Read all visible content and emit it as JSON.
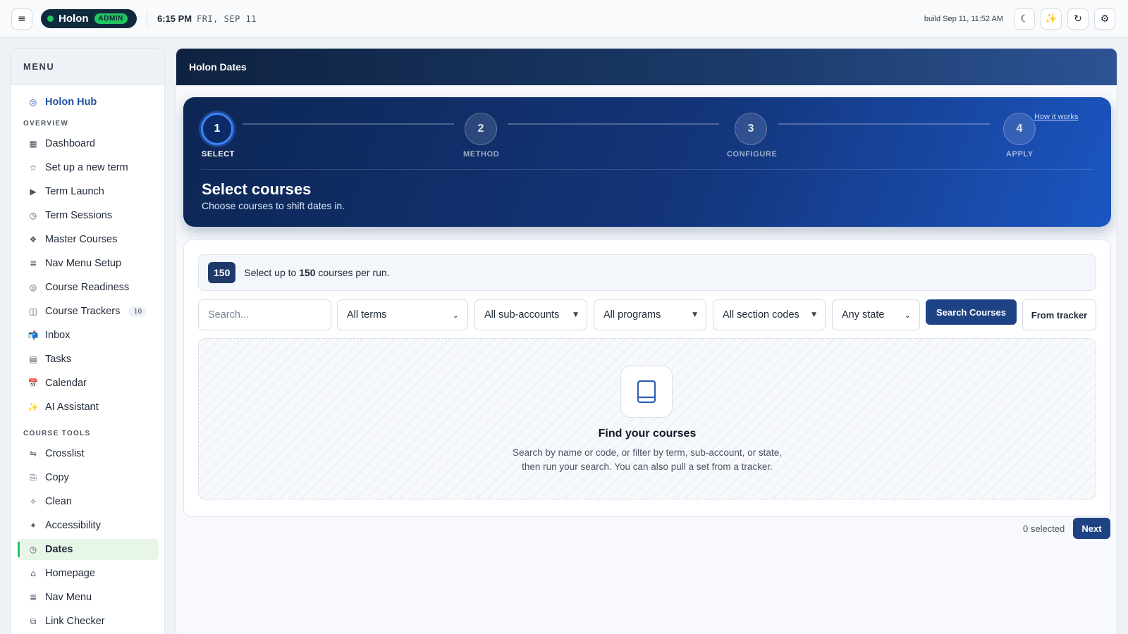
{
  "topbar": {
    "menu_icon": "hamburger-icon",
    "brand_name": "Holon",
    "brand_badge": "ADMIN",
    "time": "6:15 PM",
    "date": "FRI, SEP 11",
    "build": "build Sep 11, 11:52 AM",
    "actions": [
      {
        "icon": "moon-icon",
        "glyph": "☾"
      },
      {
        "icon": "sparkles-icon",
        "glyph": "✨"
      },
      {
        "icon": "refresh-icon",
        "glyph": "↻"
      },
      {
        "icon": "gear-icon",
        "glyph": "⚙"
      }
    ]
  },
  "sidebar": {
    "heading": "MENU",
    "hub": {
      "label": "Holon Hub",
      "glyph": "◎"
    },
    "sections": [
      {
        "title": "OVERVIEW",
        "items": [
          {
            "label": "Dashboard",
            "glyph": "▦"
          },
          {
            "label": "Set up a new term",
            "glyph": "☆"
          },
          {
            "label": "Term Launch",
            "glyph": "▶"
          },
          {
            "label": "Term Sessions",
            "glyph": "◷"
          },
          {
            "label": "Master Courses",
            "glyph": "❖"
          },
          {
            "label": "Nav Menu Setup",
            "glyph": "≣"
          },
          {
            "label": "Course Readiness",
            "glyph": "◎"
          },
          {
            "label": "Course Trackers",
            "glyph": "◫",
            "count": "10"
          },
          {
            "label": "Inbox",
            "glyph": "📬"
          },
          {
            "label": "Tasks",
            "glyph": "▤"
          },
          {
            "label": "Calendar",
            "glyph": "📅"
          },
          {
            "label": "AI Assistant",
            "glyph": "✨"
          }
        ]
      },
      {
        "title": "COURSE TOOLS",
        "items": [
          {
            "label": "Crosslist",
            "glyph": "⇋"
          },
          {
            "label": "Copy",
            "glyph": "⎘"
          },
          {
            "label": "Clean",
            "glyph": "✧"
          },
          {
            "label": "Accessibility",
            "glyph": "✦"
          },
          {
            "label": "Dates",
            "glyph": "◷",
            "active": true
          },
          {
            "label": "Homepage",
            "glyph": "⌂"
          },
          {
            "label": "Nav Menu",
            "glyph": "≣"
          },
          {
            "label": "Link Checker",
            "glyph": "⧉"
          }
        ]
      }
    ]
  },
  "main": {
    "title": "Holon Dates",
    "wizard": {
      "steps": [
        {
          "number": "1",
          "label": "SELECT",
          "current": true
        },
        {
          "number": "2",
          "label": "METHOD"
        },
        {
          "number": "3",
          "label": "CONFIGURE"
        },
        {
          "number": "4",
          "label": "APPLY"
        }
      ],
      "help_link": "How it works",
      "title": "Select courses",
      "subtitle": "Choose courses to shift dates in."
    },
    "limit": {
      "badge": "150",
      "text_prefix": "Select up to ",
      "text_value": "150",
      "text_suffix": " courses per run."
    },
    "filters": {
      "search_placeholder": "Search...",
      "term": "All terms",
      "subaccount": "All sub-accounts",
      "program": "All programs",
      "section_code": "All section codes",
      "state": "Any state"
    },
    "search_button": "Search Courses",
    "tracker_button": "From tracker",
    "empty": {
      "icon": "book-icon",
      "title": "Find your courses",
      "line1": "Search by name or code, or filter by term, sub-account, or state,",
      "line2": "then run your search. You can also pull a set from a tracker."
    },
    "selected_count": "0 selected",
    "next_button": "Next"
  },
  "colors": {
    "accent": "#1e4384",
    "brand_green": "#22c55e",
    "wizard_dark": "#0d2654",
    "wizard_light": "#1b56c2"
  }
}
